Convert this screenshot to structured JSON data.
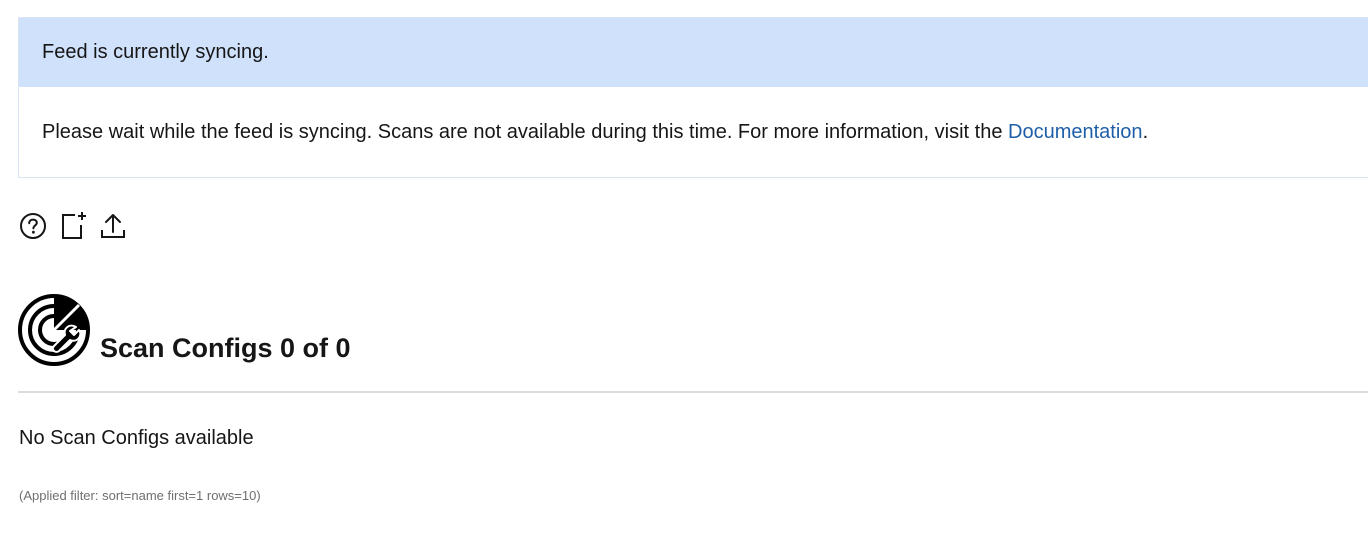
{
  "notification": {
    "title": "Feed is currently syncing.",
    "message": "Please wait while the feed is syncing. Scans are not available during this time. For more information, visit the",
    "link_label": "Documentation",
    "message_end": "."
  },
  "toolbar": {
    "icons": [
      "help-icon",
      "new-scan-config-icon",
      "import-icon"
    ]
  },
  "section": {
    "title": "Scan Configs 0 of 0",
    "icon": "scan-config-icon"
  },
  "empty_message": "No Scan Configs available",
  "applied_filter": "(Applied filter: sort=name first=1 rows=10)"
}
